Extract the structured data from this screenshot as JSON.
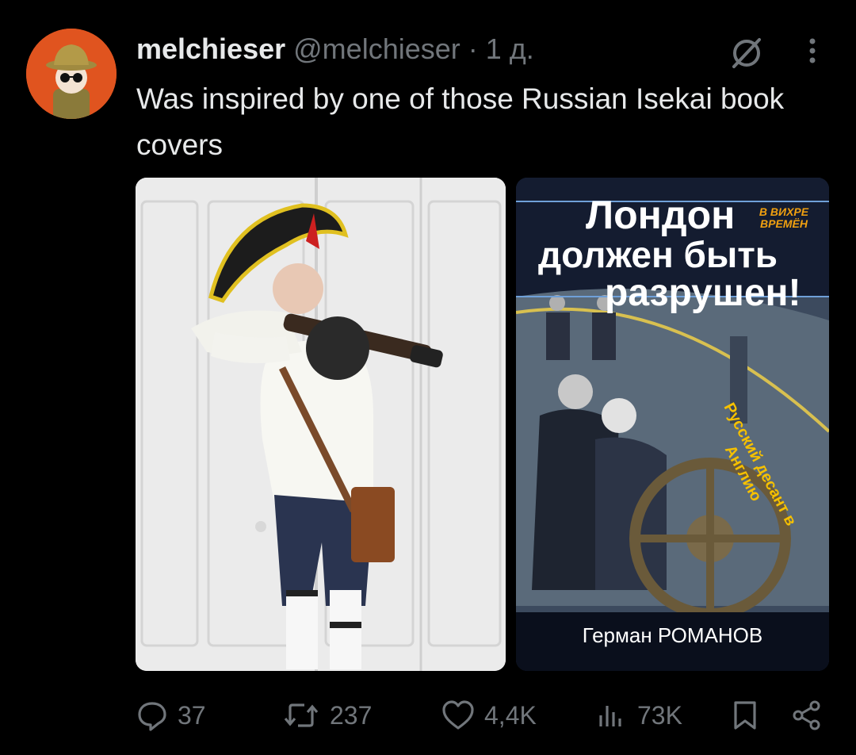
{
  "tweet": {
    "display_name": "melchieser",
    "handle": "@melchieser",
    "separator": "·",
    "time": "1 д.",
    "text": "Was inspired by one of those Russian Isekai book covers"
  },
  "book_cover": {
    "title_line1": "Лондон",
    "title_line2": "должен быть",
    "title_line3": "разрушен!",
    "series": "В ВИХРЕ ВРЕМЁН",
    "subtitle": "Русский десант в Англию",
    "author": "Герман РОМАНОВ"
  },
  "actions": {
    "replies": "37",
    "reposts": "237",
    "likes": "4,4K",
    "views": "73K"
  },
  "colors": {
    "background": "#000000",
    "text": "#e7e9ea",
    "muted": "#71767b",
    "avatar_bg": "#e0541f"
  },
  "icons": [
    "grok-icon",
    "more-icon",
    "reply-icon",
    "repost-icon",
    "like-icon",
    "views-icon",
    "bookmark-icon",
    "share-icon"
  ]
}
